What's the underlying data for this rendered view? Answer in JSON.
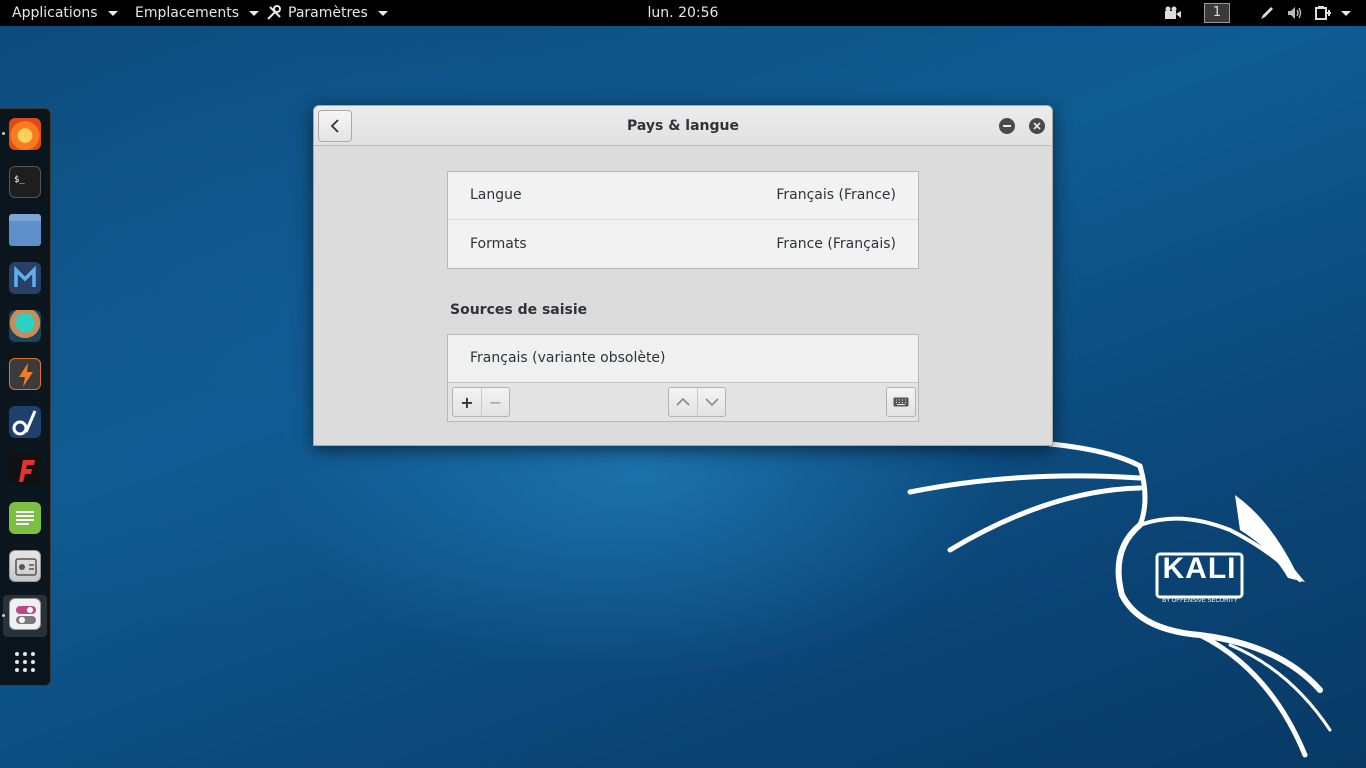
{
  "topbar": {
    "applications": "Applications",
    "places": "Emplacements",
    "settings": "Paramètres",
    "clock": "lun. 20:56",
    "workspace": "1"
  },
  "dock": {
    "items": [
      "firefox-icon",
      "terminal-icon",
      "files-icon",
      "metasploit-icon",
      "armitage-icon",
      "burpsuite-icon",
      "maltego-icon",
      "faraday-icon",
      "text-editor-icon",
      "tweaks-icon",
      "settings-icon",
      "show-apps-icon"
    ]
  },
  "window": {
    "title": "Pays & langue",
    "language_label": "Langue",
    "language_value": "Français (France)",
    "formats_label": "Formats",
    "formats_value": "France (Français)",
    "input_sources_title": "Sources de saisie",
    "input_sources": [
      "Français (variante obsolète)"
    ],
    "add_label": "+",
    "remove_label": "−"
  },
  "wallpaper": {
    "brand": "KALI",
    "tagline": "BY OFFENSIVE SECURITY"
  }
}
